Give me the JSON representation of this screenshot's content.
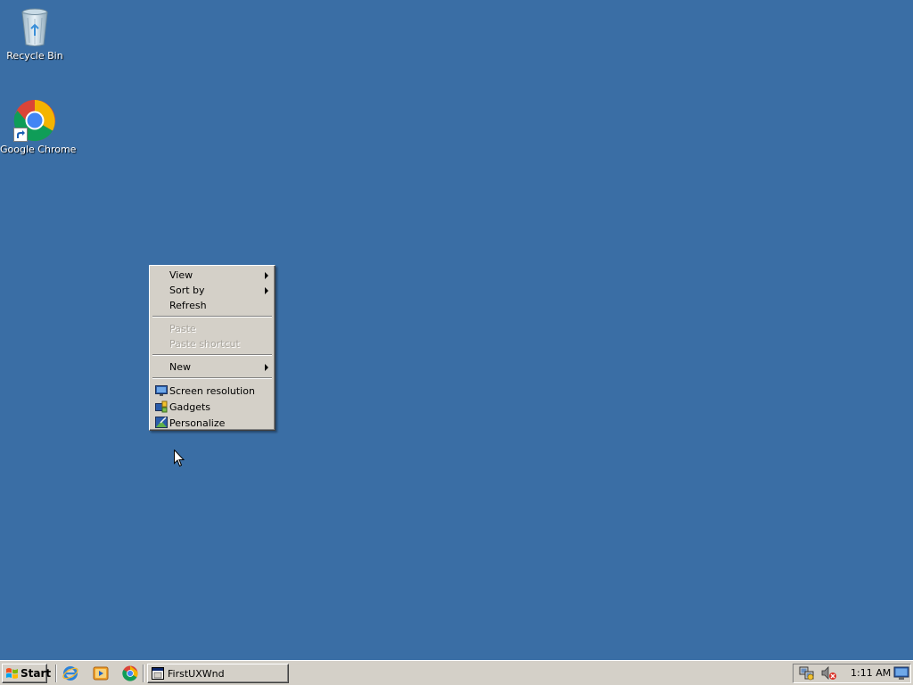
{
  "desktop": {
    "background_color": "#3a6ea5",
    "icons": [
      {
        "label": "Recycle Bin",
        "icon": "recycle-bin-icon"
      },
      {
        "label": "Google Chrome",
        "icon": "chrome-icon"
      }
    ]
  },
  "context_menu": {
    "items": [
      {
        "label": "View",
        "submenu": true,
        "enabled": true
      },
      {
        "label": "Sort by",
        "submenu": true,
        "enabled": true
      },
      {
        "label": "Refresh",
        "submenu": false,
        "enabled": true
      },
      {
        "label": "Paste",
        "submenu": false,
        "enabled": false
      },
      {
        "label": "Paste shortcut",
        "submenu": false,
        "enabled": false
      },
      {
        "label": "New",
        "submenu": true,
        "enabled": true
      },
      {
        "label": "Screen resolution",
        "icon": "screen-resolution-icon",
        "enabled": true
      },
      {
        "label": "Gadgets",
        "icon": "gadgets-icon",
        "enabled": true
      },
      {
        "label": "Personalize",
        "icon": "personalize-icon",
        "enabled": true
      }
    ]
  },
  "taskbar": {
    "start_label": "Start",
    "quick_launch": [
      {
        "icon": "internet-explorer-icon"
      },
      {
        "icon": "media-player-icon"
      },
      {
        "icon": "chrome-icon"
      }
    ],
    "tasks": [
      {
        "label": "FirstUXWnd",
        "icon": "window-app-icon"
      }
    ],
    "tray": {
      "icons": [
        "network-icon",
        "volume-muted-icon",
        "display-icon"
      ],
      "clock": "1:11 AM"
    }
  }
}
